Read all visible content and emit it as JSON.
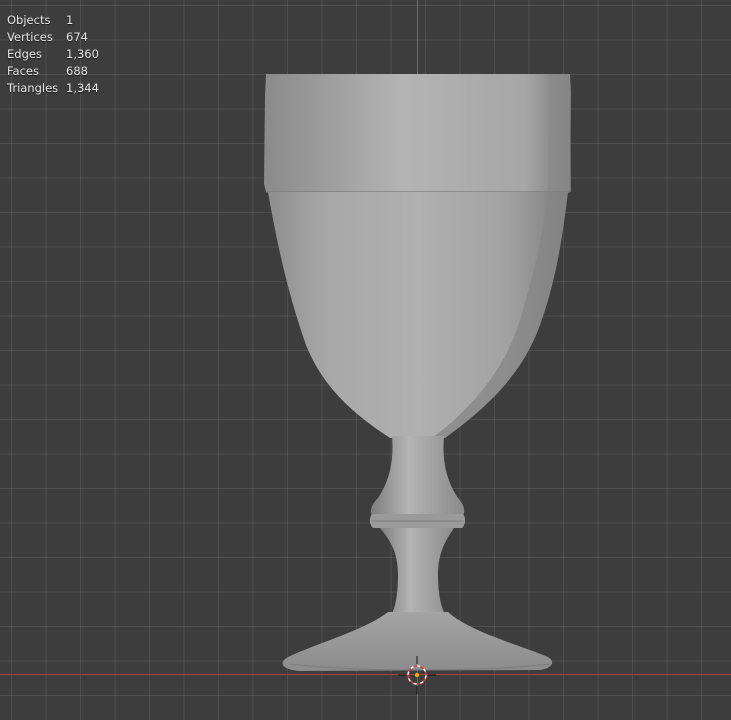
{
  "viewport": {
    "colors": {
      "background": "#3d3d3d",
      "grid": "#555555",
      "x_axis": "#b5434a",
      "y_axis": "#4a78b8",
      "mesh": "#a9a9a9",
      "origin": "#ffa500"
    }
  },
  "statistics": [
    {
      "label": "Objects",
      "value": "1"
    },
    {
      "label": "Vertices",
      "value": "674"
    },
    {
      "label": "Edges",
      "value": "1,360"
    },
    {
      "label": "Faces",
      "value": "688"
    },
    {
      "label": "Triangles",
      "value": "1,344"
    }
  ],
  "icons": {
    "cursor": "3d-cursor-icon",
    "origin": "object-origin-icon"
  }
}
